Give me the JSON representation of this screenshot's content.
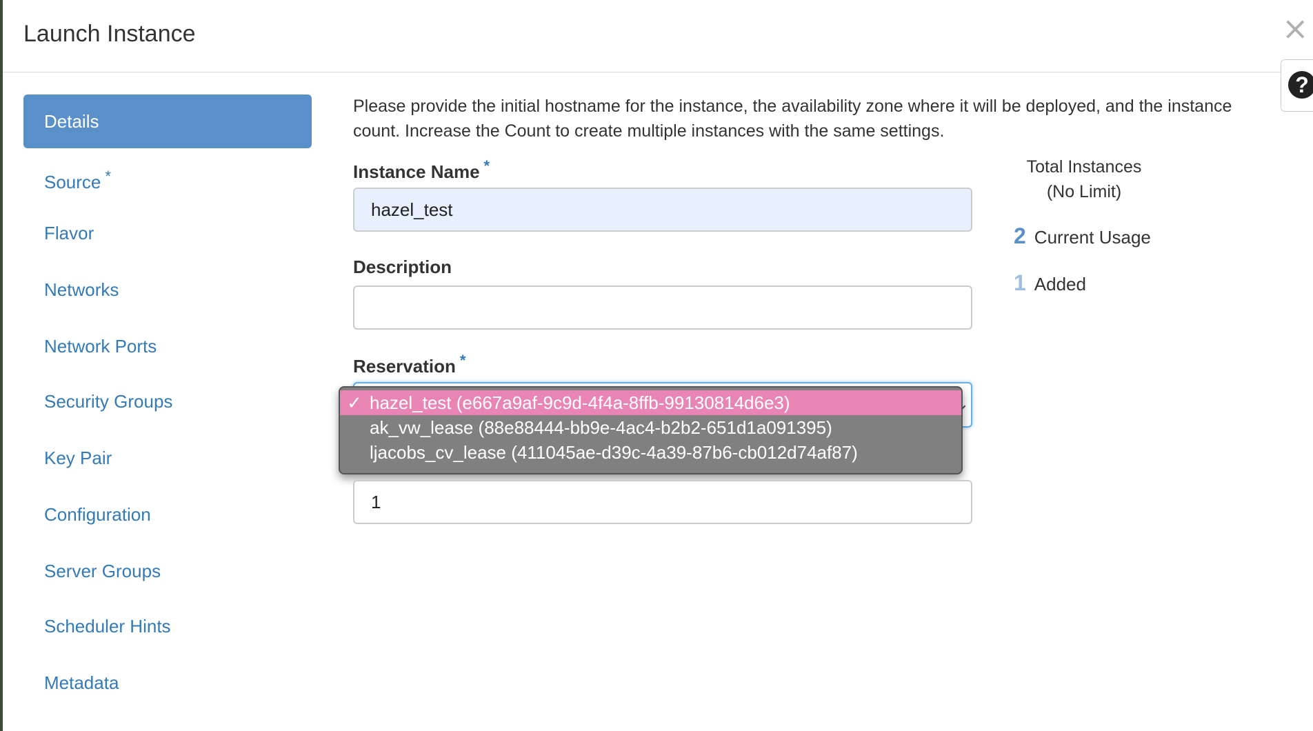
{
  "dialog": {
    "title": "Launch Instance",
    "close_label": "×",
    "help_label": "?"
  },
  "nav": {
    "items": [
      {
        "label": "Details",
        "active": true,
        "required": false
      },
      {
        "label": "Source",
        "active": false,
        "required": true
      },
      {
        "label": "Flavor",
        "active": false,
        "required": false
      },
      {
        "label": "Networks",
        "active": false,
        "required": false
      },
      {
        "label": "Network Ports",
        "active": false,
        "required": false
      },
      {
        "label": "Security Groups",
        "active": false,
        "required": false
      },
      {
        "label": "Key Pair",
        "active": false,
        "required": false
      },
      {
        "label": "Configuration",
        "active": false,
        "required": false
      },
      {
        "label": "Server Groups",
        "active": false,
        "required": false
      },
      {
        "label": "Scheduler Hints",
        "active": false,
        "required": false
      },
      {
        "label": "Metadata",
        "active": false,
        "required": false
      }
    ],
    "required_marker": "*"
  },
  "form": {
    "description_text": "Please provide the initial hostname for the instance, the availability zone where it will be deployed, and the instance count. Increase the Count to create multiple instances with the same settings.",
    "instance_name": {
      "label": "Instance Name",
      "value": "hazel_test"
    },
    "description": {
      "label": "Description",
      "value": ""
    },
    "reservation": {
      "label": "Reservation",
      "options": [
        {
          "label": "hazel_test (e667a9af-9c9d-4f4a-8ffb-99130814d6e3)",
          "selected": true
        },
        {
          "label": "ak_vw_lease (88e88444-bb9e-4ac4-b2b2-651d1a091395)",
          "selected": false
        },
        {
          "label": "ljacobs_cv_lease (411045ae-d39c-4a39-87b6-cb012d74af87)",
          "selected": false
        }
      ],
      "check_mark": "✓"
    },
    "count": {
      "value": "1"
    }
  },
  "quota": {
    "title_line1": "Total Instances",
    "title_line2": "(No Limit)",
    "current_usage": {
      "value": "2",
      "label": "Current Usage"
    },
    "added": {
      "value": "1",
      "label": "Added"
    }
  },
  "colors": {
    "active_nav_bg": "#5a90ca",
    "link": "#337ab7",
    "selected_option": "#e985b4",
    "dropdown_bg": "#808080"
  }
}
